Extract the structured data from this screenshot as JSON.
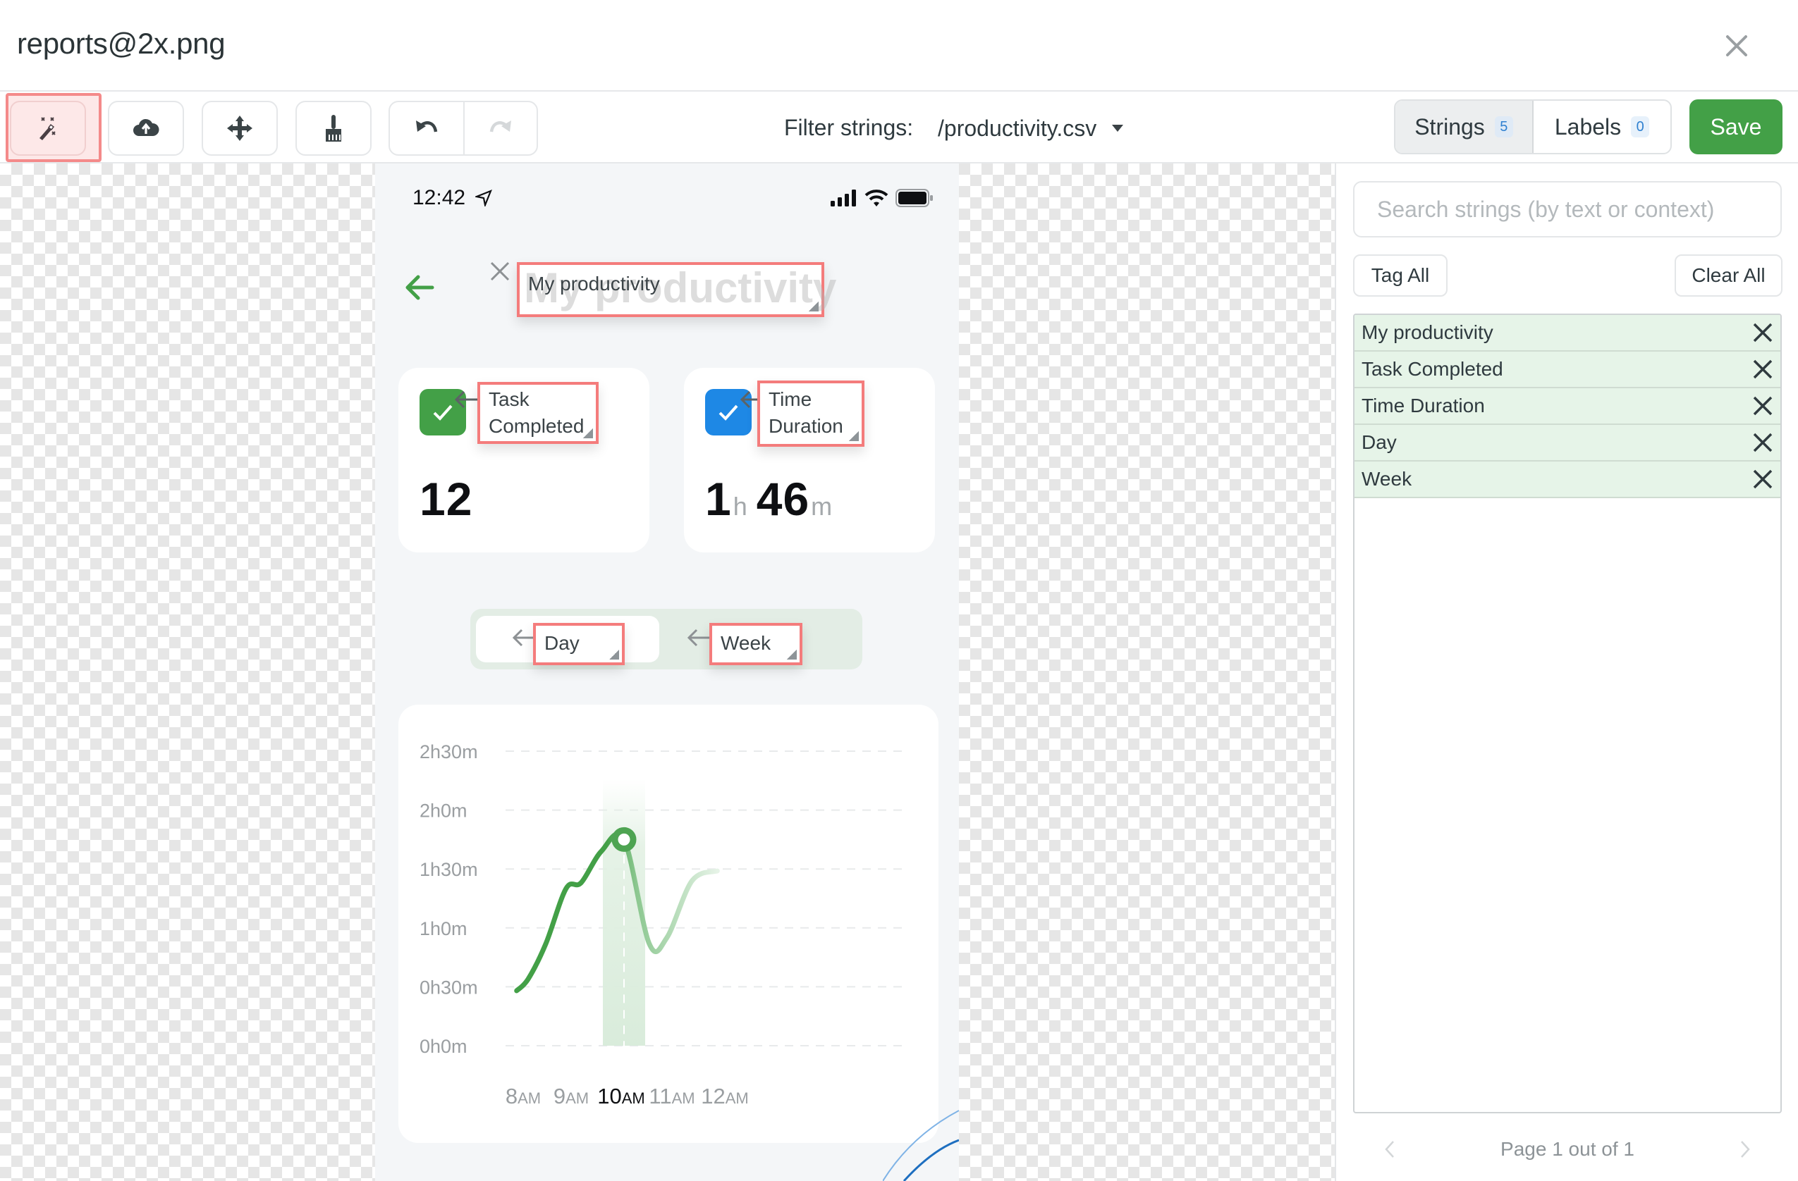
{
  "window": {
    "title": "reports@2x.png",
    "close_icon": "close-icon"
  },
  "toolbar": {
    "tools": [
      {
        "name": "magic-wand",
        "icon": "magic-wand-icon",
        "active": true
      },
      {
        "name": "upload",
        "icon": "cloud-upload-icon",
        "active": false
      },
      {
        "name": "move",
        "icon": "move-arrows-icon",
        "active": false
      },
      {
        "name": "broom",
        "icon": "broom-icon",
        "active": false
      },
      {
        "name": "undo",
        "icon": "undo-icon",
        "active": false
      },
      {
        "name": "redo",
        "icon": "redo-icon",
        "active": false,
        "disabled": true
      }
    ],
    "filter_label": "Filter strings:",
    "filter_value": "/productivity.csv",
    "tabs": [
      {
        "label": "Strings",
        "count": "5",
        "active": true
      },
      {
        "label": "Labels",
        "count": "0",
        "active": false
      }
    ],
    "save_label": "Save",
    "colors": {
      "accent": "#43a047",
      "selection": "#f47c7c",
      "badge_text": "#2f80d0"
    }
  },
  "phone": {
    "status_time": "12:42",
    "title_ghost": "My productivity",
    "overlays": {
      "title": "My productivity",
      "task": "Task Completed",
      "time": "Time Duration",
      "day": "Day",
      "week": "Week"
    },
    "cards": {
      "tasks": {
        "value": "12",
        "check_color": "#43a047"
      },
      "time": {
        "hours": "1",
        "hours_unit": "h",
        "minutes": "46",
        "minutes_unit": "m",
        "check_color": "#1e88e5"
      }
    }
  },
  "chart_data": {
    "type": "line",
    "title": "",
    "xlabel": "",
    "ylabel": "",
    "categories": [
      "8AM",
      "9AM",
      "10AM",
      "11AM",
      "12AM"
    ],
    "x_tick_labels": [
      {
        "num": "8",
        "suffix": "AM"
      },
      {
        "num": "9",
        "suffix": "AM"
      },
      {
        "num": "10",
        "suffix": "AM"
      },
      {
        "num": "11",
        "suffix": "AM"
      },
      {
        "num": "12",
        "suffix": "AM"
      }
    ],
    "y_tick_labels": [
      "2h30m",
      "2h0m",
      "1h30m",
      "1h0m",
      "0h30m",
      "0h0m"
    ],
    "ylim_minutes": [
      0,
      150
    ],
    "series": [
      {
        "name": "Time Duration",
        "x_hours": [
          7.87,
          8.1,
          8.45,
          8.85,
          9.15,
          9.55,
          10.0,
          10.5,
          10.85,
          11.35,
          11.85
        ],
        "y_minutes": [
          28,
          34,
          52,
          80,
          83,
          99,
          105,
          52,
          55,
          84,
          89
        ],
        "color": "#43a047"
      }
    ],
    "highlight": {
      "category": "10AM",
      "value_minutes": 105
    },
    "grid": true,
    "legend": "none"
  },
  "panel": {
    "search_placeholder": "Search strings (by text or context)",
    "search_value": "",
    "tag_all_label": "Tag All",
    "clear_all_label": "Clear All",
    "strings": [
      {
        "text": "My productivity"
      },
      {
        "text": "Task Completed"
      },
      {
        "text": "Time Duration"
      },
      {
        "text": "Day"
      },
      {
        "text": "Week"
      }
    ],
    "pagination": "Page 1 out of 1"
  }
}
